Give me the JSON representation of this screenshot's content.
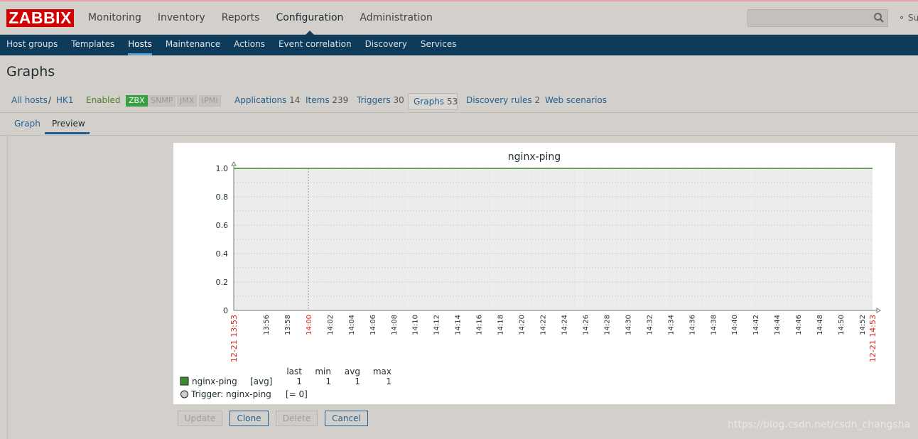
{
  "app": {
    "logo": "ZABBIX",
    "main_nav": [
      "Monitoring",
      "Inventory",
      "Reports",
      "Configuration",
      "Administration"
    ],
    "main_nav_active": "Configuration",
    "support": "Su",
    "sub_nav": [
      "Host groups",
      "Templates",
      "Hosts",
      "Maintenance",
      "Actions",
      "Event correlation",
      "Discovery",
      "Services"
    ],
    "sub_nav_active": "Hosts"
  },
  "page": {
    "title": "Graphs"
  },
  "hostbar": {
    "all_hosts": "All hosts",
    "sep": "/",
    "host": "HK1",
    "status": "Enabled",
    "protocols": [
      "ZBX",
      "SNMP",
      "JMX",
      "IPMI"
    ],
    "links": [
      {
        "label": "Applications",
        "count": "14"
      },
      {
        "label": "Items",
        "count": "239"
      },
      {
        "label": "Triggers",
        "count": "30"
      },
      {
        "label": "Graphs",
        "count": "53"
      },
      {
        "label": "Discovery rules",
        "count": "2"
      },
      {
        "label": "Web scenarios",
        "count": ""
      }
    ]
  },
  "form_tabs": [
    "Graph",
    "Preview"
  ],
  "form_tabs_active": "Preview",
  "chart_data": {
    "type": "line",
    "title": "nginx-ping",
    "ylim": [
      0,
      1.0
    ],
    "y_ticks": [
      "1.0",
      "0.8",
      "0.6",
      "0.4",
      "0.2",
      "0"
    ],
    "x_start_label": "12-21 13:53",
    "x_end_label": "12-21 14:53",
    "x_ticks": [
      "13:56",
      "13:58",
      "14:00",
      "14:02",
      "14:04",
      "14:06",
      "14:08",
      "14:10",
      "14:12",
      "14:14",
      "14:16",
      "14:18",
      "14:20",
      "14:22",
      "14:24",
      "14:26",
      "14:28",
      "14:30",
      "14:32",
      "14:34",
      "14:36",
      "14:38",
      "14:40",
      "14:42",
      "14:44",
      "14:46",
      "14:48",
      "14:50",
      "14:52"
    ],
    "x_tick_highlight": "14:00",
    "series": [
      {
        "name": "nginx-ping",
        "func": "[avg]",
        "color": "#3c8b2e",
        "values": [
          1,
          1
        ]
      }
    ],
    "legend_headers": [
      "last",
      "min",
      "avg",
      "max"
    ],
    "legend_values": [
      "1",
      "1",
      "1",
      "1"
    ],
    "trigger": {
      "label": "Trigger: nginx-ping",
      "condition": "[= 0]"
    },
    "grid": true
  },
  "buttons": [
    {
      "label": "Update",
      "enabled": false
    },
    {
      "label": "Clone",
      "enabled": true
    },
    {
      "label": "Delete",
      "enabled": false
    },
    {
      "label": "Cancel",
      "enabled": true
    }
  ],
  "watermark": "https://blog.csdn.net/csdn_changsha"
}
